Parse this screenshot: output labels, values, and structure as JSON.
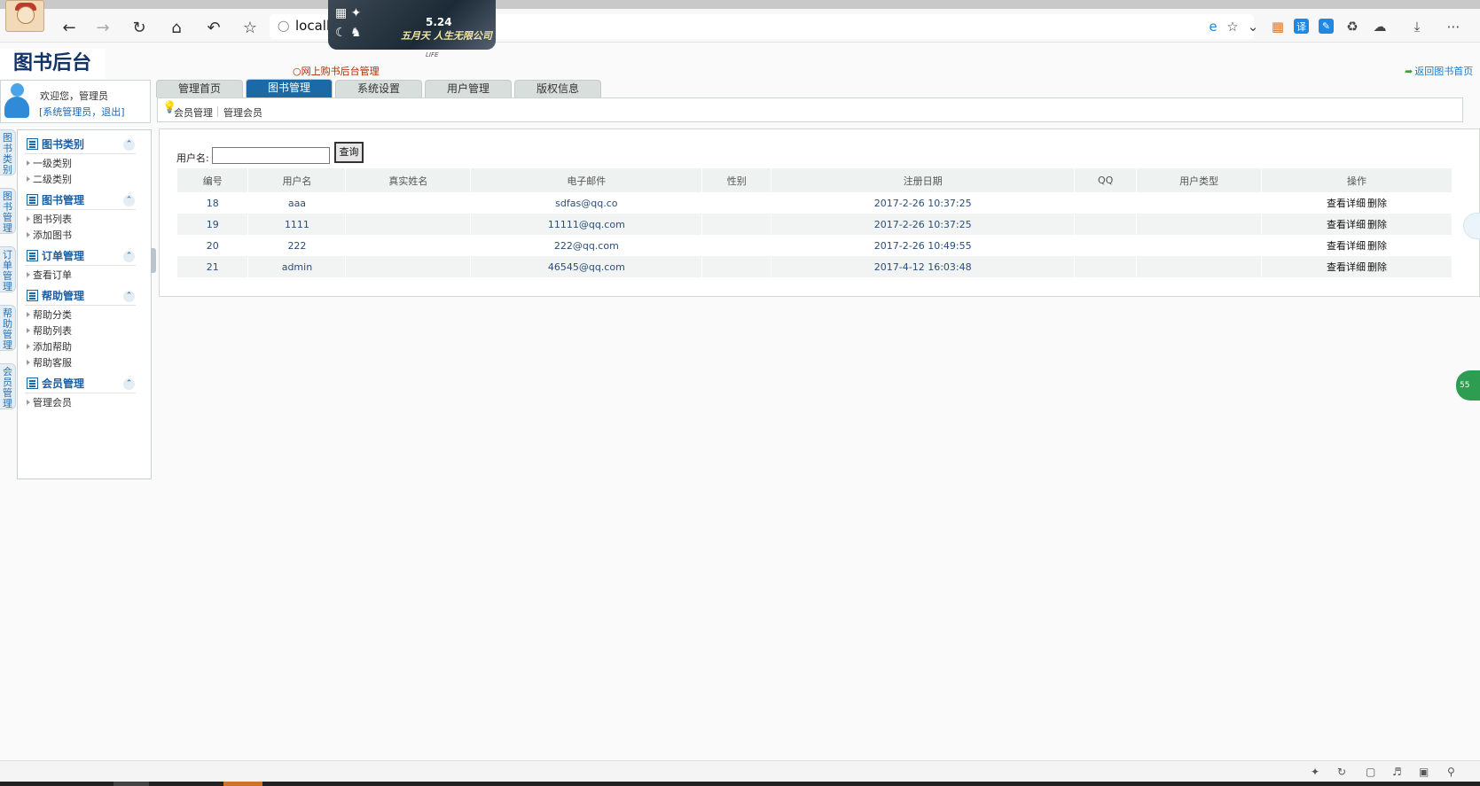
{
  "browser": {
    "url_text": "localh",
    "icons": {
      "back": "back-arrow-icon",
      "forward": "forward-arrow-icon",
      "refresh": "refresh-icon",
      "home": "home-icon",
      "undo": "undo-icon",
      "favorite": "star-icon",
      "download": "download-icon",
      "more": "more-icon"
    },
    "translate_label": "译"
  },
  "ad": {
    "date": "5.24",
    "title": "五月天 人生无限公司",
    "sub": "LIFE"
  },
  "app": {
    "title": "图书后台",
    "breadcrumb": "网上购书后台管理",
    "return_link": "返回图书首页"
  },
  "tabs": [
    {
      "label": "管理首页",
      "active": false
    },
    {
      "label": "图书管理",
      "active": true
    },
    {
      "label": "系统设置",
      "active": false
    },
    {
      "label": "用户管理",
      "active": false
    },
    {
      "label": "版权信息",
      "active": false
    }
  ],
  "subnav": {
    "item1": "会员管理",
    "item2": "管理会员"
  },
  "welcome": {
    "greeting": "欢迎您，",
    "role": "管理员",
    "links": "[系统管理员，退出]"
  },
  "vtabs": [
    "图书类别",
    "图书管理",
    "订单管理",
    "帮助管理",
    "会员管理"
  ],
  "menu": [
    {
      "heading": "图书类别",
      "items": [
        "一级类别",
        "二级类别"
      ]
    },
    {
      "heading": "图书管理",
      "items": [
        "图书列表",
        "添加图书"
      ]
    },
    {
      "heading": "订单管理",
      "items": [
        "查看订单"
      ]
    },
    {
      "heading": "帮助管理",
      "items": [
        "帮助分类",
        "帮助列表",
        "添加帮助",
        "帮助客服"
      ]
    },
    {
      "heading": "会员管理",
      "items": [
        "管理会员"
      ]
    }
  ],
  "search": {
    "label": "用户名:",
    "value": "",
    "button": "查询"
  },
  "table": {
    "headers": [
      "编号",
      "用户名",
      "真实姓名",
      "电子邮件",
      "性别",
      "注册日期",
      "QQ",
      "用户类型",
      "操作"
    ],
    "rows": [
      [
        "18",
        "aaa",
        "",
        "sdfas@qq.co",
        "",
        "2017-2-26 10:37:25",
        "",
        ""
      ],
      [
        "19",
        "1111",
        "",
        "11111@qq.com",
        "",
        "2017-2-26 10:37:25",
        "",
        ""
      ],
      [
        "20",
        "222",
        "",
        "222@qq.com",
        "",
        "2017-2-26 10:49:55",
        "",
        ""
      ],
      [
        "21",
        "admin",
        "",
        "46545@qq.com",
        "",
        "2017-4-12 16:03:48",
        "",
        ""
      ]
    ],
    "op_detail": "查看详细",
    "op_delete": "删除"
  },
  "right_badge": "55",
  "colors": {
    "brand": "#13346b",
    "active_tab": "#1b6aa5",
    "link": "#1d67b3",
    "breadcrumb": "#b02800"
  }
}
